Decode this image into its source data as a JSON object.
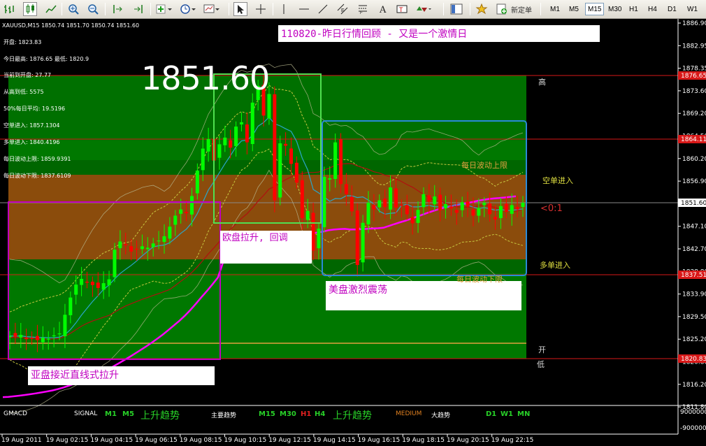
{
  "toolbar": {
    "new_order_label": "新定单",
    "timeframes": [
      "M1",
      "M5",
      "M15",
      "M30",
      "H1",
      "H4",
      "D1",
      "W1"
    ],
    "active_timeframe": "M15"
  },
  "chart": {
    "symbol_info": "XAUUSD,M15  1850.74 1851.70 1850.74 1851.60",
    "stats": [
      "开盘: 1823.83",
      "今日最高: 1876.65  最低: 1820.9",
      "当前到开盘: 27.77",
      "从高到低: 5575",
      "50%每日平均: 19.5196",
      "空单进入: 1857.1304",
      "多单进入: 1840.4196",
      "每日波动上限: 1859.9391",
      "每日波动下限: 1837.6109"
    ],
    "big_price": "1851.60",
    "title_note": "110820-昨日行情回顾 - 又是一个激情日",
    "notes": {
      "europe": "欧盘拉升, 回调",
      "asia": "亚盘接近直线式拉升",
      "us": "美盘激烈震荡"
    },
    "zone_labels": {
      "high": "高",
      "short_entry": "空单进入",
      "ratio": "<0:1",
      "long_entry": "多单进入",
      "open": "开",
      "low": "低",
      "upper_limit": "每日波动上限",
      "lower_limit": "每日波动下限"
    },
    "price_axis": [
      "1886.90",
      "1882.95",
      "1878.35",
      "1873.60",
      "1869.20",
      "1864.50",
      "1860.20",
      "1856.90",
      "1851.60",
      "1847.10",
      "1842.70",
      "1838.80",
      "1833.90",
      "1829.50",
      "1825.20",
      "1820.80",
      "1816.20",
      "1811.80"
    ],
    "price_tags": [
      {
        "value": "1876.65",
        "color": "#d81818"
      },
      {
        "value": "1864.11",
        "color": "#d81818"
      },
      {
        "value": "1851.60",
        "color": "#ffffff"
      },
      {
        "value": "1837.51",
        "color": "#d81818"
      },
      {
        "value": "1820.83",
        "color": "#d81818"
      }
    ],
    "time_axis": [
      "19 Aug 2011",
      "19 Aug 02:15",
      "19 Aug 04:15",
      "19 Aug 06:15",
      "19 Aug 08:15",
      "19 Aug 10:15",
      "19 Aug 12:15",
      "19 Aug 14:15",
      "19 Aug 16:15",
      "19 Aug 18:15",
      "19 Aug 20:15",
      "19 Aug 22:15"
    ],
    "indicator_axis": [
      "9000000",
      "-9000000"
    ],
    "colors": {
      "green_zone": "#007800",
      "brown_zone": "#8b4c0c",
      "bull": "#00ff00",
      "bear": "#ff0000",
      "ma_magenta": "#ff00ff",
      "ma_cyan": "#2aa6c8",
      "ma_red": "#b01010",
      "band_yellow": "#c8c840",
      "box_green": "#50e050",
      "box_blue": "#2a8ad8",
      "box_magenta": "#c000c0",
      "indicator_green": "#28d028",
      "indicator_orange": "#e08020"
    }
  },
  "indicator": {
    "name": "GMACD",
    "signal_label": "SIGNAL",
    "tf1": [
      "M1",
      "M5"
    ],
    "trend1": "上升趋势",
    "main_trend": "主要趋势",
    "tf2": [
      "M15",
      "M30"
    ],
    "tf2_red": "H1",
    "tf2_h4": "H4",
    "trend2": "上升趋势",
    "medium": "MEDIUM",
    "big_trend": "大趋势",
    "tf3": [
      "D1",
      "W1",
      "MN"
    ]
  }
}
